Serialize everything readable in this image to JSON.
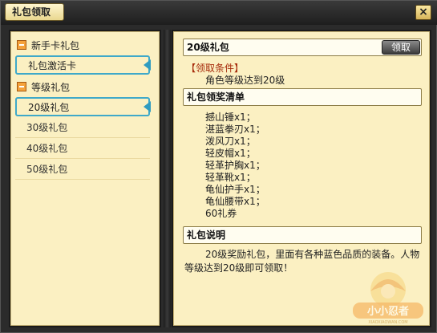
{
  "window": {
    "title": "礼包领取",
    "close_label": "×"
  },
  "sidebar": {
    "groups": [
      {
        "label": "新手卡礼包",
        "items": [
          {
            "label": "礼包激活卡"
          }
        ]
      },
      {
        "label": "等级礼包",
        "items": [
          {
            "label": "20级礼包"
          },
          {
            "label": "30级礼包"
          },
          {
            "label": "40级礼包"
          },
          {
            "label": "50级礼包"
          }
        ]
      }
    ],
    "selected": "20级礼包"
  },
  "detail": {
    "title": "20级礼包",
    "claim_button": "领取",
    "condition_title": "【领取条件】",
    "condition_text": "角色等级达到20级",
    "rewards_header": "礼包领奖清单",
    "rewards": [
      "撼山锤x1；",
      "湛蓝拳刃x1；",
      "泼风刀x1；",
      "轻皮帽x1；",
      "轻革护胸x1；",
      "轻革靴x1；",
      "龟仙护手x1；",
      "龟仙腰带x1；",
      "60礼券"
    ],
    "desc_header": "礼包说明",
    "desc_text": "20级奖励礼包，里面有各种蓝色品质的装备。人物等级达到20级即可领取！"
  },
  "colors": {
    "panel_bg": "#fbf0c2",
    "selection": "#3fa9c9",
    "condition_title": "#a62a0a"
  },
  "watermark": {
    "text": "小小忍者",
    "subtext": "XIAOXIAOWAN.COM"
  }
}
